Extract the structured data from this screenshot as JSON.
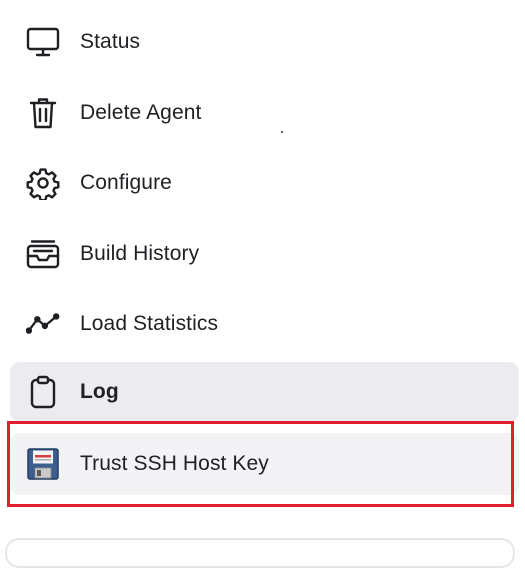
{
  "menu": {
    "items": [
      {
        "label": "Status",
        "icon": "monitor-icon"
      },
      {
        "label": "Delete Agent",
        "icon": "trash-icon"
      },
      {
        "label": "Configure",
        "icon": "gear-icon"
      },
      {
        "label": "Build History",
        "icon": "inbox-tray-icon"
      },
      {
        "label": "Load Statistics",
        "icon": "line-chart-icon"
      },
      {
        "label": "Log",
        "icon": "clipboard-icon",
        "active": true
      },
      {
        "label": "Trust SSH Host Key",
        "icon": "floppy-disk-icon",
        "highlighted": true
      }
    ]
  },
  "colors": {
    "active_background": "#ececf0",
    "highlight_border": "#e11d2e"
  }
}
